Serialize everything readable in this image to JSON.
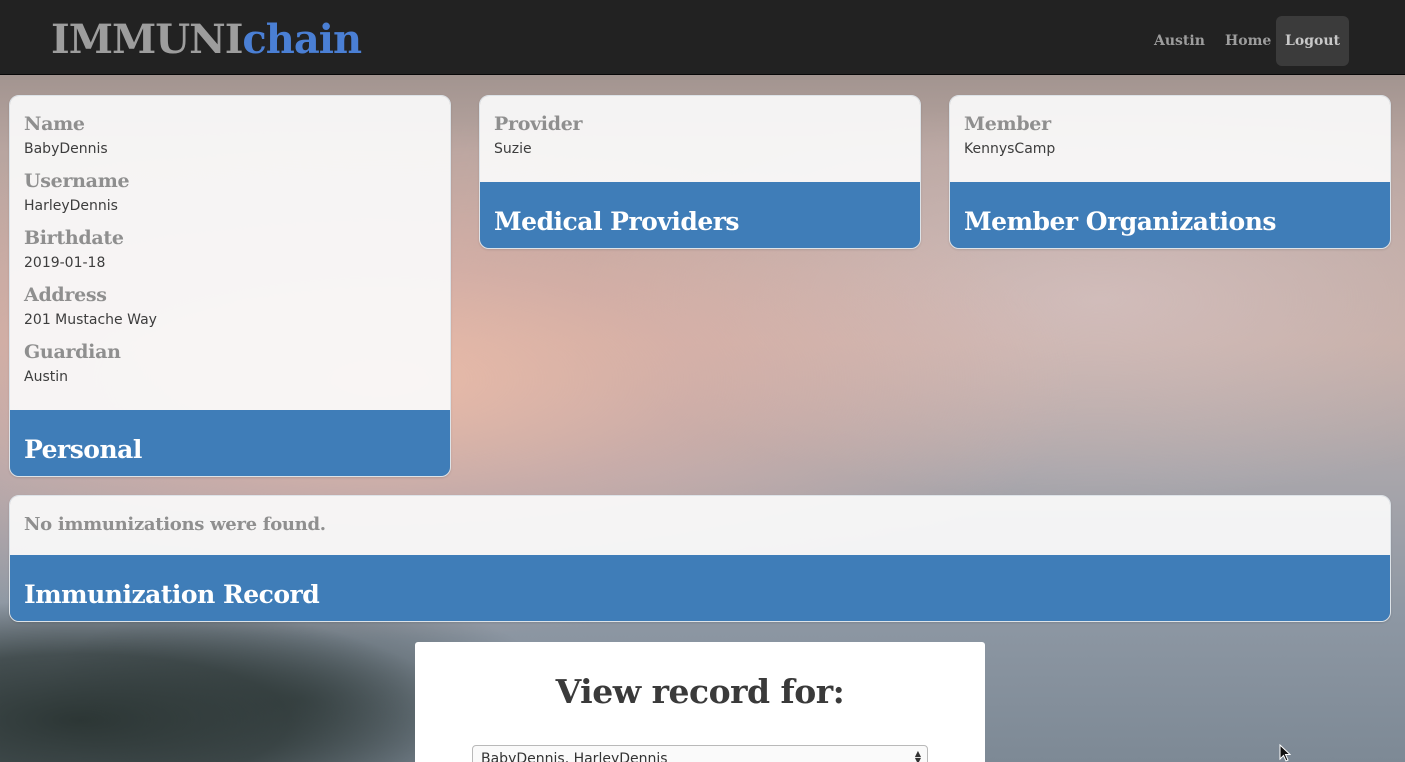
{
  "brand": {
    "part1": "IMMUNI",
    "part2": "chain"
  },
  "nav": {
    "user": "Austin",
    "home": "Home",
    "logout": "Logout"
  },
  "personal": {
    "title": "Personal",
    "fields": [
      {
        "label": "Name",
        "value": "BabyDennis"
      },
      {
        "label": "Username",
        "value": "HarleyDennis"
      },
      {
        "label": "Birthdate",
        "value": "2019-01-18"
      },
      {
        "label": "Address",
        "value": "201 Mustache Way"
      },
      {
        "label": "Guardian",
        "value": "Austin"
      }
    ]
  },
  "providers": {
    "title": "Medical Providers",
    "label": "Provider",
    "value": "Suzie"
  },
  "members": {
    "title": "Member Organizations",
    "label": "Member",
    "value": "KennysCamp"
  },
  "immunization": {
    "title": "Immunization Record",
    "message": "No immunizations were found."
  },
  "view_record": {
    "title": "View record for:",
    "selected": "BabyDennis, HarleyDennis"
  },
  "colors": {
    "navbar": "#222222",
    "accent": "#3f7db8",
    "brand_blue": "#4a7fd4",
    "brand_gray": "#9d9d9d"
  }
}
